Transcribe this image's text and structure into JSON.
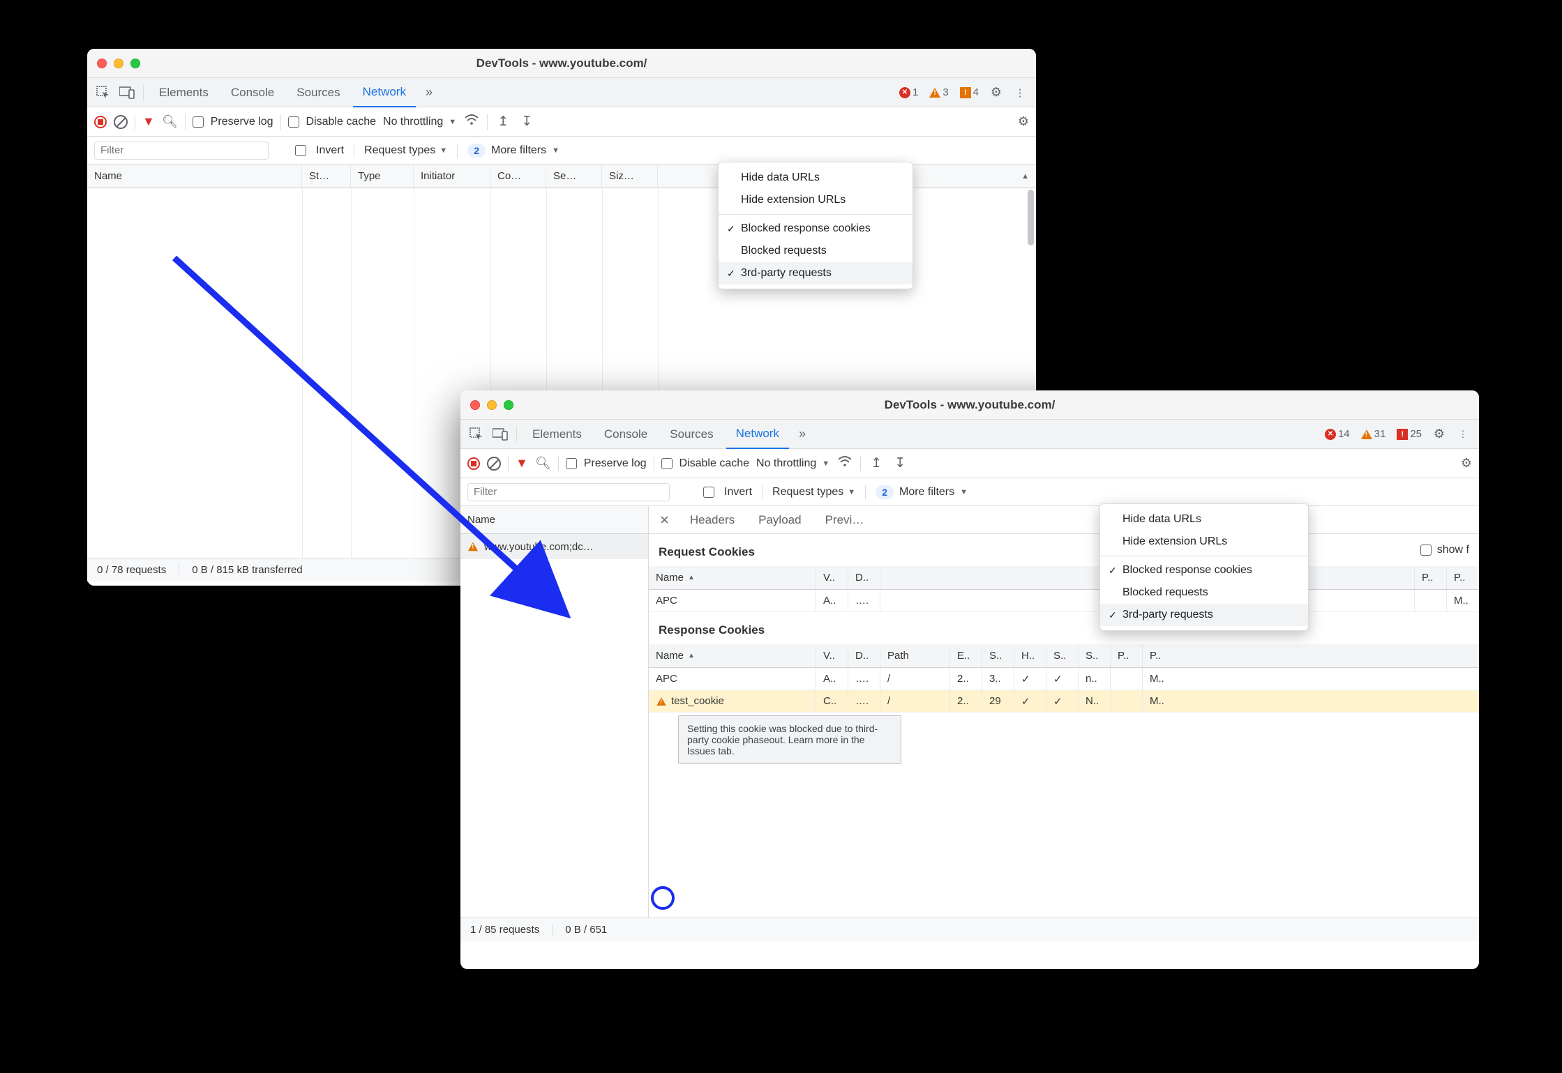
{
  "window1": {
    "title": "DevTools - www.youtube.com/",
    "tabs": {
      "t0": "Elements",
      "t1": "Console",
      "t2": "Sources",
      "t3": "Network"
    },
    "errors": "1",
    "warnings": "3",
    "issues": "4",
    "toolbar": {
      "preserve": "Preserve log",
      "disable": "Disable cache",
      "throttle": "No throttling"
    },
    "filter": {
      "placeholder": "Filter",
      "invert": "Invert",
      "reqtypes": "Request types",
      "morecount": "2",
      "more": "More filters"
    },
    "menu": {
      "m0": "Hide data URLs",
      "m1": "Hide extension URLs",
      "m2": "Blocked response cookies",
      "m3": "Blocked requests",
      "m4": "3rd-party requests"
    },
    "cols": {
      "c0": "Name",
      "c1": "St…",
      "c2": "Type",
      "c3": "Initiator",
      "c4": "Co…",
      "c5": "Se…",
      "c6": "Siz…"
    },
    "status": {
      "req": "0 / 78 requests",
      "xfer": "0 B / 815 kB transferred"
    }
  },
  "window2": {
    "title": "DevTools - www.youtube.com/",
    "tabs": {
      "t0": "Elements",
      "t1": "Console",
      "t2": "Sources",
      "t3": "Network"
    },
    "errors": "14",
    "warnings": "31",
    "issues": "25",
    "toolbar": {
      "preserve": "Preserve log",
      "disable": "Disable cache",
      "throttle": "No throttling"
    },
    "filter": {
      "placeholder": "Filter",
      "invert": "Invert",
      "reqtypes": "Request types",
      "morecount": "2",
      "more": "More filters"
    },
    "menu": {
      "m0": "Hide data URLs",
      "m1": "Hide extension URLs",
      "m2": "Blocked response cookies",
      "m3": "Blocked requests",
      "m4": "3rd-party requests"
    },
    "left": {
      "name_col": "Name",
      "req0": "www.youtube.com;dc…"
    },
    "right": {
      "close": "×",
      "rtabs": {
        "r0": "Headers",
        "r1": "Payload",
        "r2": "Previ…"
      },
      "reqcookies": "Request Cookies",
      "showfilt": "show f",
      "respcookies": "Response Cookies",
      "cols_short": {
        "c0": "Name",
        "c1": "V..",
        "c2": "D..",
        "c3": "Path",
        "c4": "E..",
        "c5": "S..",
        "c6": "H..",
        "c7": "S..",
        "c8": "S..",
        "c9": "P..",
        "c10": "P.."
      },
      "cols_short_end": {
        "c9": "P.."
      },
      "req_row": {
        "name": "APC",
        "v": "A..",
        "d": "….",
        "p": "",
        "e": "",
        "s1": "",
        "h": "",
        "s2": "",
        "s3": "",
        "pa": "",
        "pr": "M.."
      },
      "resp_rows": [
        {
          "name": "APC",
          "v": "A..",
          "d": "….",
          "path": "/",
          "e": "2..",
          "s": "3..",
          "h": "✓",
          "s2": "✓",
          "s3": "n..",
          "pa": "",
          "pr": "M.."
        },
        {
          "name": "test_cookie",
          "v": "C..",
          "d": "….",
          "path": "/",
          "e": "2..",
          "s": "29",
          "h": "✓",
          "s2": "✓",
          "s3": "N..",
          "pa": "",
          "pr": "M.."
        }
      ],
      "tooltip": "Setting this cookie was blocked due to third-party cookie phaseout. Learn more in the Issues tab."
    },
    "status": {
      "req": "1 / 85 requests",
      "xfer": "0 B / 651"
    }
  }
}
